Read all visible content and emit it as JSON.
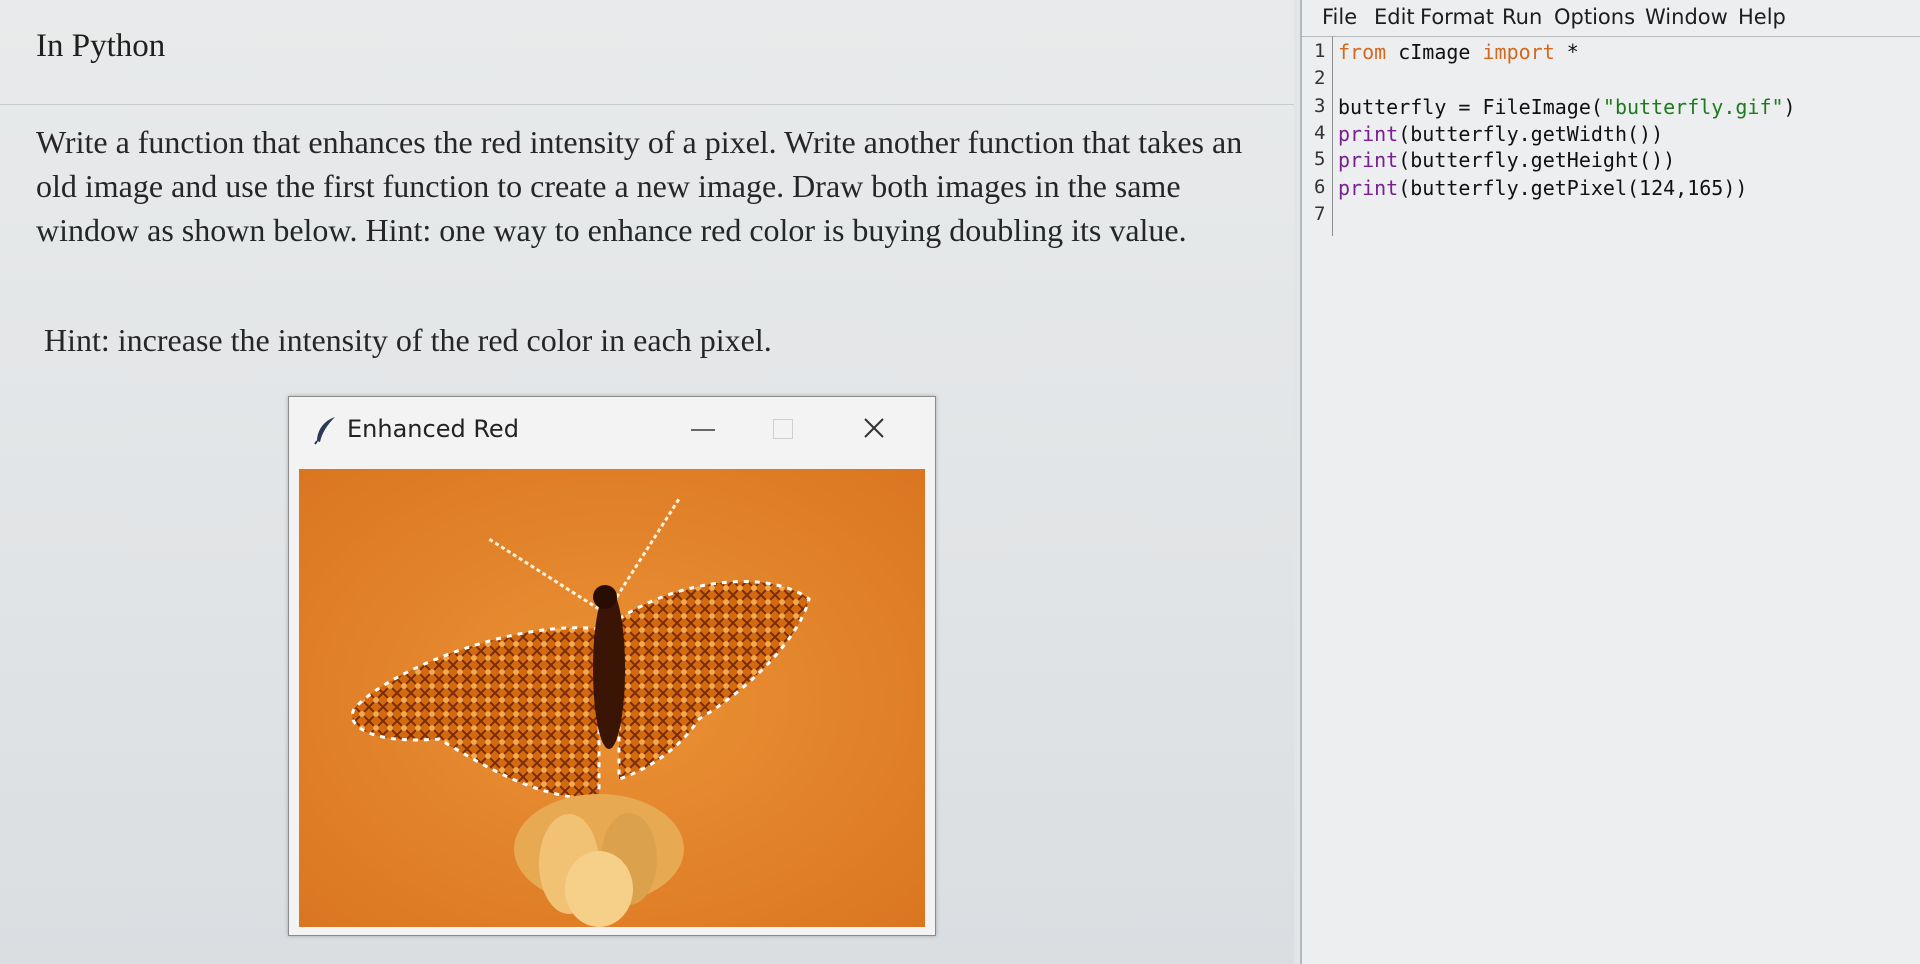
{
  "question": {
    "title": "In Python",
    "paragraph": "Write a function that enhances the red intensity of a pixel. Write another function that takes an old image and use the first function to create a new image. Draw both images in the same window as shown below. Hint: one way to enhance red color is buying doubling its value.",
    "hint": "Hint: increase the intensity of the red color in each pixel."
  },
  "tk_window": {
    "title": "Enhanced Red",
    "icon": "feather-icon",
    "close_glyph": "✕",
    "image_description_color": "#e48a2e"
  },
  "editor": {
    "menu": [
      "File",
      "Edit",
      "Format",
      "Run",
      "Options",
      "Window",
      "Help"
    ],
    "line_numbers": [
      "1",
      "2",
      "3",
      "4",
      "5",
      "6",
      "7"
    ],
    "lines": [
      {
        "pre": "",
        "kw1": "from",
        "mid": " cImage ",
        "kw2": "import",
        "post": " *"
      },
      {
        "text": ""
      },
      {
        "pre": "butterfly = FileImage(",
        "str": "\"butterfly.gif\"",
        "post": ")"
      },
      {
        "fn": "print",
        "post": "(butterfly.getWidth())"
      },
      {
        "fn": "print",
        "post": "(butterfly.getHeight())"
      },
      {
        "fn": "print",
        "post": "(butterfly.getPixel(124,165))"
      },
      {
        "text": ""
      }
    ],
    "colors": {
      "keyword": "#d2691e",
      "string": "#1d7a1d",
      "builtin": "#7a1f91"
    }
  }
}
